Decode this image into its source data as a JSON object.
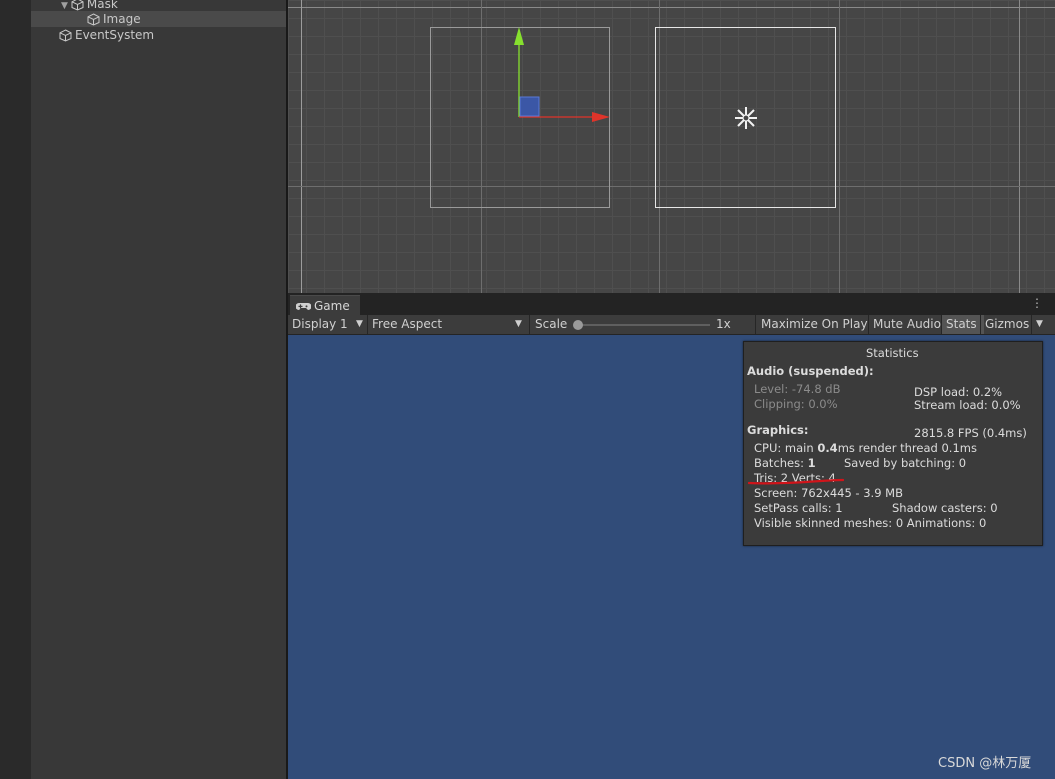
{
  "hierarchy": {
    "items": [
      {
        "label": "Mask",
        "foldout": "▼"
      },
      {
        "label": "Image"
      },
      {
        "label": "EventSystem"
      }
    ]
  },
  "game": {
    "tab_label": "Game",
    "menu_glyph": "⋮",
    "toolbar": {
      "display": "Display 1",
      "aspect": "Free Aspect",
      "scale_label": "Scale",
      "scale_value": "1x",
      "scale_level": 0.0,
      "maximize": "Maximize On Play",
      "mute": "Mute Audio",
      "stats": "Stats",
      "gizmos": "Gizmos",
      "dropdown_glyph": "▼"
    }
  },
  "stats": {
    "title": "Statistics",
    "audio_header": "Audio (suspended):",
    "level": "Level: -74.8 dB",
    "clipping": "Clipping: 0.0%",
    "dsp_load": "DSP load: 0.2%",
    "stream_load": "Stream load: 0.0%",
    "graphics_header": "Graphics:",
    "fps": "2815.8 FPS (0.4ms)",
    "cpu_prefix": "CPU: main ",
    "cpu_main": "0.4",
    "cpu_suffix": "ms  render thread 0.1ms",
    "batches_prefix": "Batches: ",
    "batches_value": "1",
    "saved_by_batching": "Saved by batching: 0",
    "tris_verts": "Tris: 2   Verts: 4",
    "screen": "Screen: 762x445 - 3.9 MB",
    "setpass": "SetPass calls: 1",
    "shadow_casters": "Shadow casters: 0",
    "skinned": "Visible skinned meshes: 0  Animations: 0"
  },
  "watermark": "CSDN @林万厦",
  "colors": {
    "game_background": "#314c79",
    "scene_background": "#464646",
    "annotation_underline": "#d0141a",
    "gizmo_x": "#e0342a",
    "gizmo_y": "#86e02e"
  }
}
